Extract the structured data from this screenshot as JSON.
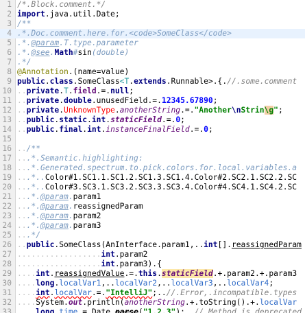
{
  "editor": {
    "current_line": 4,
    "lines": [
      {
        "n": "1",
        "segs": [
          [
            "/*.Block.comment.*/",
            "cmt"
          ]
        ]
      },
      {
        "n": "2",
        "segs": [
          [
            "import",
            "kw"
          ],
          [
            ".java.util.",
            ""
          ],
          [
            "Date",
            ""
          ],
          [
            ";",
            ""
          ]
        ]
      },
      {
        "n": "3",
        "segs": [
          [
            "/**",
            "doc"
          ]
        ]
      },
      {
        "n": "4",
        "segs": [
          [
            ".*.Doc.comment.here.for.",
            "doc"
          ],
          [
            "<code>",
            "doc"
          ],
          [
            "SomeClass",
            "doc"
          ],
          [
            "</code>",
            "doc"
          ]
        ]
      },
      {
        "n": "5",
        "segs": [
          [
            ".*.",
            "doc"
          ],
          [
            "@param",
            "doctag"
          ],
          [
            ".",
            "doc"
          ],
          [
            "T",
            "doc"
          ],
          [
            ".type.parameter",
            "doc"
          ]
        ]
      },
      {
        "n": "6",
        "segs": [
          [
            ".*.",
            "doc"
          ],
          [
            "@see",
            "doctag"
          ],
          [
            ".",
            "doc"
          ],
          [
            "Math",
            "kw"
          ],
          [
            "#",
            "doc"
          ],
          [
            "sin",
            "meth"
          ],
          [
            "(double)",
            "doc"
          ]
        ]
      },
      {
        "n": "7",
        "segs": [
          [
            ".*/",
            "doc"
          ]
        ]
      },
      {
        "n": "8",
        "segs": [
          [
            "@Annotation",
            "ann"
          ],
          [
            ".(",
            ""
          ],
          [
            "name",
            "annparam"
          ],
          [
            "=",
            ""
          ],
          [
            "value",
            ""
          ],
          [
            ")",
            ""
          ]
        ]
      },
      {
        "n": "9",
        "segs": [
          [
            "public",
            "kw"
          ],
          [
            ".",
            ""
          ],
          [
            "class",
            "kw"
          ],
          [
            ".",
            ""
          ],
          [
            "SomeClass",
            "cls"
          ],
          [
            "<T",
            "tparam"
          ],
          [
            ".",
            ""
          ],
          [
            "extends",
            "kw"
          ],
          [
            ".",
            ""
          ],
          [
            "Runnable",
            ""
          ],
          [
            ">.{.",
            ""
          ],
          [
            "//.some.comment",
            "cmt"
          ]
        ]
      },
      {
        "n": "10",
        "segs": [
          [
            "..",
            "ws"
          ],
          [
            "private",
            "kw"
          ],
          [
            ".",
            ""
          ],
          [
            "T",
            "tparam"
          ],
          [
            ".",
            ""
          ],
          [
            "field",
            "field"
          ],
          [
            ".=.",
            ""
          ],
          [
            "null",
            "kw"
          ],
          [
            ";",
            ""
          ]
        ]
      },
      {
        "n": "11",
        "segs": [
          [
            "..",
            "ws"
          ],
          [
            "private",
            "kw"
          ],
          [
            ".",
            ""
          ],
          [
            "double",
            "kw"
          ],
          [
            ".",
            ""
          ],
          [
            "unusedField",
            ""
          ],
          [
            ".=.",
            ""
          ],
          [
            "12345.67890",
            "num"
          ],
          [
            ";",
            ""
          ]
        ]
      },
      {
        "n": "12",
        "segs": [
          [
            "..",
            "ws"
          ],
          [
            "private",
            "kw"
          ],
          [
            ".",
            ""
          ],
          [
            "UnknownType",
            "unknown"
          ],
          [
            ".",
            ""
          ],
          [
            "anotherString",
            "field-i"
          ],
          [
            ".=.",
            ""
          ],
          [
            "\"Another",
            "str"
          ],
          [
            "\\n",
            "esc"
          ],
          [
            "Strin",
            "str"
          ],
          [
            "\\g",
            "esc-invalid"
          ],
          [
            "\"",
            "str"
          ],
          [
            ";",
            ""
          ]
        ]
      },
      {
        "n": "13",
        "segs": [
          [
            "..",
            "ws"
          ],
          [
            "public",
            "kw"
          ],
          [
            ".",
            ""
          ],
          [
            "static",
            "kw"
          ],
          [
            ".",
            ""
          ],
          [
            "int",
            "kw"
          ],
          [
            ".",
            ""
          ],
          [
            "staticField",
            "static-field"
          ],
          [
            ".=.",
            ""
          ],
          [
            "0",
            "num"
          ],
          [
            ";",
            ""
          ]
        ]
      },
      {
        "n": "14",
        "segs": [
          [
            "..",
            "ws"
          ],
          [
            "public",
            "kw"
          ],
          [
            ".",
            ""
          ],
          [
            "final",
            "kw"
          ],
          [
            ".",
            ""
          ],
          [
            "int",
            "kw"
          ],
          [
            ".",
            ""
          ],
          [
            "instanceFinalField",
            "field-i"
          ],
          [
            ".=.",
            ""
          ],
          [
            "0",
            "num"
          ],
          [
            ";",
            ""
          ]
        ]
      },
      {
        "n": "15",
        "segs": []
      },
      {
        "n": "16",
        "segs": [
          [
            "..",
            "ws"
          ],
          [
            "/**",
            "doc"
          ]
        ]
      },
      {
        "n": "17",
        "segs": [
          [
            "..",
            "ws"
          ],
          [
            ".*.Semantic.highlighting:",
            "doc"
          ]
        ]
      },
      {
        "n": "18",
        "segs": [
          [
            "..",
            "ws"
          ],
          [
            ".*.Generated.spectrum.to.pick.colors.for.local.variables.a",
            "doc"
          ]
        ]
      },
      {
        "n": "19",
        "segs": [
          [
            "..",
            "ws"
          ],
          [
            ".*..",
            "doc"
          ],
          [
            "Color#1.SC1.1.SC1.2.SC1.3.SC1.4.Color#2.SC2.1.SC2.2.SC",
            ""
          ]
        ]
      },
      {
        "n": "20",
        "segs": [
          [
            "..",
            "ws"
          ],
          [
            ".*..",
            "doc"
          ],
          [
            "Color#3.SC3.1.SC3.2.SC3.3.SC3.4.Color#4.SC4.1.SC4.2.SC",
            ""
          ]
        ]
      },
      {
        "n": "21",
        "segs": [
          [
            "..",
            "ws"
          ],
          [
            ".*.",
            "doc"
          ],
          [
            "@param",
            "doctag"
          ],
          [
            ".",
            "doc"
          ],
          [
            "param1",
            ""
          ]
        ]
      },
      {
        "n": "22",
        "segs": [
          [
            "..",
            "ws"
          ],
          [
            ".*.",
            "doc"
          ],
          [
            "@param",
            "doctag"
          ],
          [
            ".",
            "doc"
          ],
          [
            "reassignedParam",
            ""
          ]
        ]
      },
      {
        "n": "23",
        "segs": [
          [
            "..",
            "ws"
          ],
          [
            ".*.",
            "doc"
          ],
          [
            "@param",
            "doctag"
          ],
          [
            ".",
            "doc"
          ],
          [
            "param2",
            ""
          ]
        ]
      },
      {
        "n": "24",
        "segs": [
          [
            "..",
            "ws"
          ],
          [
            ".*.",
            "doc"
          ],
          [
            "@param",
            "doctag"
          ],
          [
            ".",
            "doc"
          ],
          [
            "param3",
            ""
          ]
        ]
      },
      {
        "n": "25",
        "segs": [
          [
            "..",
            "ws"
          ],
          [
            ".*/",
            "doc"
          ]
        ]
      },
      {
        "n": "26",
        "segs": [
          [
            "..",
            "ws"
          ],
          [
            "public",
            "kw"
          ],
          [
            ".",
            ""
          ],
          [
            "SomeClass",
            "ctor"
          ],
          [
            "(",
            ""
          ],
          [
            "AnInterface",
            "iface"
          ],
          [
            ".",
            ""
          ],
          [
            "param1",
            "param"
          ],
          [
            ",..",
            ""
          ],
          [
            "int",
            "kw"
          ],
          [
            "[].",
            ""
          ],
          [
            "reassignedParam",
            "reassigned"
          ]
        ]
      },
      {
        "n": "27",
        "segs": [
          [
            "..................",
            "ws"
          ],
          [
            "int",
            "kw"
          ],
          [
            ".",
            ""
          ],
          [
            "param2",
            "param"
          ]
        ]
      },
      {
        "n": "28",
        "segs": [
          [
            "..................",
            "ws"
          ],
          [
            "int",
            "kw"
          ],
          [
            ".",
            ""
          ],
          [
            "param3",
            "param"
          ],
          [
            ").{",
            ""
          ]
        ]
      },
      {
        "n": "29",
        "segs": [
          [
            "....",
            "ws"
          ],
          [
            "int",
            "kw"
          ],
          [
            ".",
            ""
          ],
          [
            "reassignedValue",
            "reassigned"
          ],
          [
            ".=.",
            ""
          ],
          [
            "this",
            "kw"
          ],
          [
            ".",
            ""
          ],
          [
            "staticField",
            "static-hl"
          ],
          [
            ".+.",
            ""
          ],
          [
            "param2",
            "param"
          ],
          [
            ".+.",
            ""
          ],
          [
            "param3",
            "param"
          ]
        ]
      },
      {
        "n": "30",
        "segs": [
          [
            "....",
            "ws"
          ],
          [
            "long",
            "kw"
          ],
          [
            ".",
            ""
          ],
          [
            "localVar1",
            "local"
          ],
          [
            ",..",
            ""
          ],
          [
            "localVar2",
            "local"
          ],
          [
            ",..",
            ""
          ],
          [
            "localVar3",
            "local"
          ],
          [
            ",..",
            ""
          ],
          [
            "localVar4",
            "local"
          ],
          [
            ";",
            ""
          ]
        ]
      },
      {
        "n": "31",
        "segs": [
          [
            "....",
            "ws"
          ],
          [
            "int",
            "kw err"
          ],
          [
            ".",
            ""
          ],
          [
            "localVar",
            "local err"
          ],
          [
            ".=.",
            ""
          ],
          [
            "\"IntelliJ\"",
            "str err"
          ],
          [
            ";..",
            ""
          ],
          [
            "//.Error,.incompatible.types",
            "cmt"
          ]
        ]
      },
      {
        "n": "32",
        "segs": [
          [
            "....",
            "ws"
          ],
          [
            "System",
            ""
          ],
          [
            ".",
            ""
          ],
          [
            "out",
            "stat-out"
          ],
          [
            ".",
            ""
          ],
          [
            "println",
            "fnname"
          ],
          [
            "(",
            ""
          ],
          [
            "anotherString",
            "field-i"
          ],
          [
            ".+.",
            ""
          ],
          [
            "toString",
            "fnname"
          ],
          [
            "().+.",
            ""
          ],
          [
            "localVar",
            "local"
          ]
        ]
      },
      {
        "n": "33",
        "segs": [
          [
            "....",
            "ws"
          ],
          [
            "long",
            "kw"
          ],
          [
            ".",
            ""
          ],
          [
            "time",
            "local"
          ],
          [
            ".=.",
            ""
          ],
          [
            "Date",
            ""
          ],
          [
            ".",
            ""
          ],
          [
            "parse",
            "method-call deprecated"
          ],
          [
            "(",
            ""
          ],
          [
            "\"1.2.3\"",
            "str"
          ],
          [
            ");..",
            ""
          ],
          [
            "//.Method.is.deprecated",
            "cmt"
          ]
        ]
      }
    ]
  }
}
